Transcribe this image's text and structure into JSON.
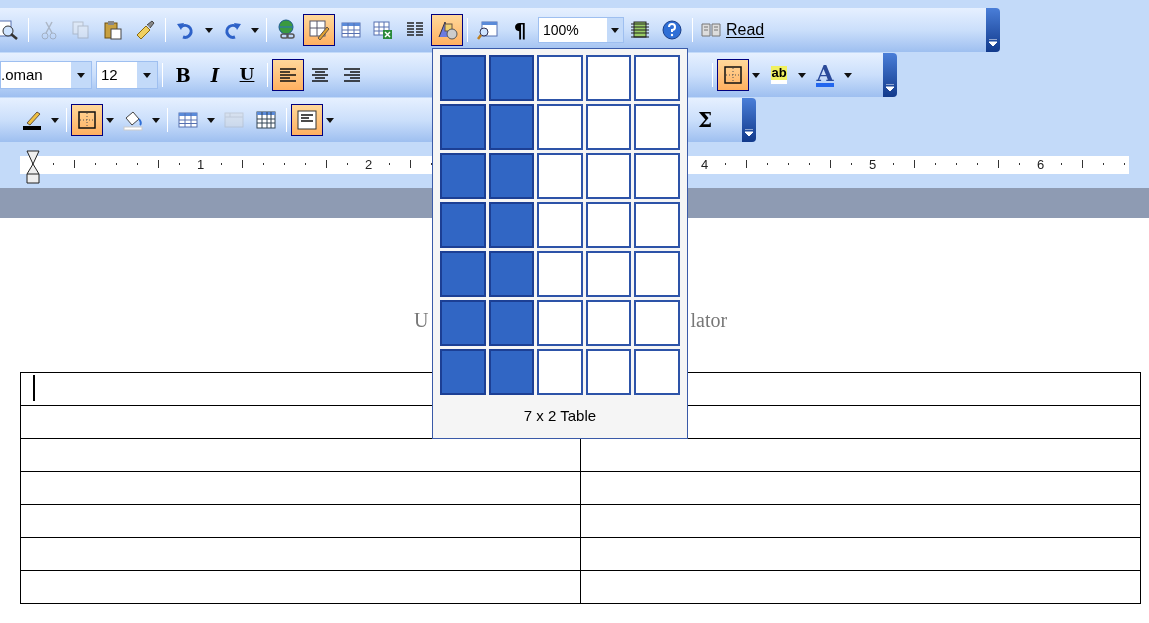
{
  "standard_toolbar": {
    "buttons": [
      {
        "kind": "icon",
        "highlighted": false,
        "disabled": false
      },
      {
        "kind": "icon",
        "highlighted": false,
        "disabled": true
      },
      {
        "kind": "icon",
        "highlighted": false,
        "disabled": true
      },
      {
        "kind": "icon",
        "highlighted": false,
        "disabled": false
      },
      {
        "kind": "icon",
        "highlighted": false,
        "disabled": false
      },
      {
        "kind": "icon",
        "highlighted": false,
        "disabled": false
      },
      {
        "kind": "icon",
        "highlighted": false,
        "disabled": false
      },
      {
        "kind": "icon",
        "highlighted": false,
        "disabled": false
      },
      {
        "kind": "icon",
        "highlighted": true,
        "disabled": false
      },
      {
        "kind": "icon",
        "highlighted": false,
        "disabled": false
      },
      {
        "kind": "icon",
        "highlighted": false,
        "disabled": false
      },
      {
        "kind": "icon",
        "highlighted": false,
        "disabled": false
      },
      {
        "kind": "icon",
        "highlighted": true,
        "disabled": false
      },
      {
        "kind": "icon",
        "highlighted": false,
        "disabled": false
      },
      {
        "kind": "glyph",
        "glyph": "¶",
        "highlighted": false,
        "disabled": false
      },
      {
        "kind": "icon",
        "highlighted": false,
        "disabled": false
      },
      {
        "kind": "icon",
        "highlighted": false,
        "disabled": false
      }
    ],
    "zoom": {
      "value": "100%"
    },
    "read_button": {
      "label": "Read"
    }
  },
  "formatting_toolbar": {
    "font": {
      "value": ".oman"
    },
    "size": {
      "value": "12"
    },
    "buttons": [
      {
        "kind": "glyph",
        "glyph": "B",
        "highlighted": false
      },
      {
        "kind": "glyph",
        "glyph": "I",
        "highlighted": false
      },
      {
        "kind": "glyph",
        "glyph": "U",
        "highlighted": false
      },
      {
        "kind": "icon",
        "highlighted": true
      },
      {
        "kind": "icon",
        "highlighted": false
      },
      {
        "kind": "icon",
        "highlighted": false
      },
      {
        "kind": "icon",
        "highlighted": true
      },
      {
        "kind": "glyph",
        "glyph": "ab",
        "highlighted": false
      },
      {
        "kind": "glyph",
        "glyph": "A",
        "highlighted": false
      }
    ]
  },
  "tables_toolbar": {
    "buttons": [
      {
        "kind": "icon",
        "highlighted": false,
        "disabled": false
      },
      {
        "kind": "icon",
        "highlighted": true,
        "disabled": false
      },
      {
        "kind": "icon",
        "highlighted": false,
        "disabled": false
      },
      {
        "kind": "icon",
        "highlighted": false,
        "disabled": false
      },
      {
        "kind": "icon",
        "highlighted": false,
        "disabled": true
      },
      {
        "kind": "icon",
        "highlighted": false,
        "disabled": false
      },
      {
        "kind": "icon",
        "highlighted": true,
        "disabled": false
      },
      {
        "kind": "glyph",
        "glyph": "Σ",
        "highlighted": false,
        "disabled": false
      }
    ]
  },
  "ruler": {
    "labels": [
      "1",
      "2",
      "4",
      "5",
      "6"
    ]
  },
  "insert_table_popup": {
    "grid": [
      {
        "cells": [
          {
            "selected": true
          },
          {
            "selected": true
          },
          {
            "selected": false
          },
          {
            "selected": false
          },
          {
            "selected": false
          }
        ]
      },
      {
        "cells": [
          {
            "selected": true
          },
          {
            "selected": true
          },
          {
            "selected": false
          },
          {
            "selected": false
          },
          {
            "selected": false
          }
        ]
      },
      {
        "cells": [
          {
            "selected": true
          },
          {
            "selected": true
          },
          {
            "selected": false
          },
          {
            "selected": false
          },
          {
            "selected": false
          }
        ]
      },
      {
        "cells": [
          {
            "selected": true
          },
          {
            "selected": true
          },
          {
            "selected": false
          },
          {
            "selected": false
          },
          {
            "selected": false
          }
        ]
      },
      {
        "cells": [
          {
            "selected": true
          },
          {
            "selected": true
          },
          {
            "selected": false
          },
          {
            "selected": false
          },
          {
            "selected": false
          }
        ]
      },
      {
        "cells": [
          {
            "selected": true
          },
          {
            "selected": true
          },
          {
            "selected": false
          },
          {
            "selected": false
          },
          {
            "selected": false
          }
        ]
      },
      {
        "cells": [
          {
            "selected": true
          },
          {
            "selected": true
          },
          {
            "selected": false
          },
          {
            "selected": false
          },
          {
            "selected": false
          }
        ]
      }
    ],
    "caption": "7 x 2 Table"
  },
  "document": {
    "title_fragments": [
      "U",
      "lator"
    ],
    "table": {
      "rows": [
        {
          "cells": [
            {
              "cursor": true
            },
            {
              "cursor": false
            }
          ]
        },
        {
          "cells": [
            {
              "cursor": false
            },
            {
              "cursor": false
            }
          ]
        },
        {
          "cells": [
            {
              "cursor": false
            },
            {
              "cursor": false
            }
          ]
        },
        {
          "cells": [
            {
              "cursor": false
            },
            {
              "cursor": false
            }
          ]
        },
        {
          "cells": [
            {
              "cursor": false
            },
            {
              "cursor": false
            }
          ]
        },
        {
          "cells": [
            {
              "cursor": false
            },
            {
              "cursor": false
            }
          ]
        },
        {
          "cells": [
            {
              "cursor": false
            },
            {
              "cursor": false
            }
          ]
        }
      ]
    }
  }
}
